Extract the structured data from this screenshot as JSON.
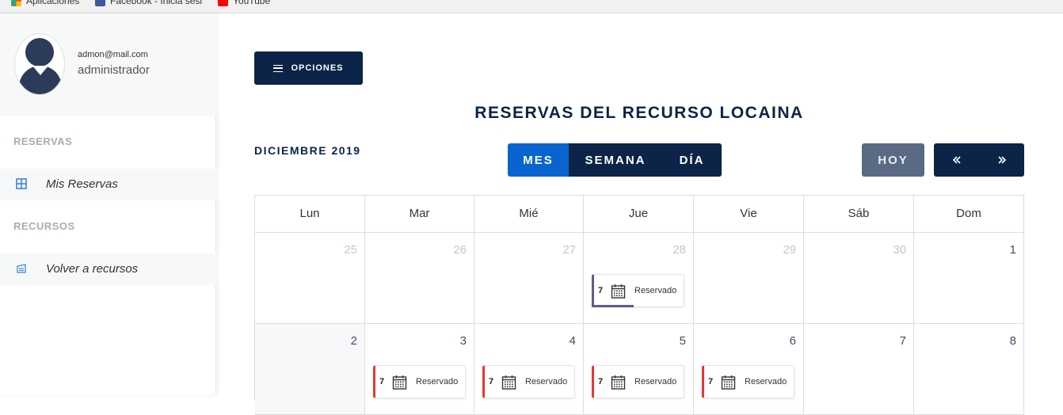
{
  "bookmarks": [
    {
      "label": "Aplicaciones",
      "icon": "apps-icon"
    },
    {
      "label": "Facebook - Inicia sesi",
      "icon": "facebook-icon"
    },
    {
      "label": "YouTube",
      "icon": "youtube-icon"
    }
  ],
  "sidebar": {
    "email": "admon@mail.com",
    "role": "administrador",
    "sections": [
      {
        "heading": "RESERVAS",
        "items": [
          {
            "label": "Mis Reservas",
            "icon": "grid-icon"
          }
        ]
      },
      {
        "heading": "RECURSOS",
        "items": [
          {
            "label": "Volver a recursos",
            "icon": "return-icon"
          }
        ]
      }
    ]
  },
  "main": {
    "options_label": "OPCIONES",
    "title": "RESERVAS DEL RECURSO LOCAINA",
    "month": "DICIEMBRE 2019",
    "views": [
      "MES",
      "SEMANA",
      "DÍA"
    ],
    "active_view": "MES",
    "today_label": "HOY",
    "prev_icon": "double-chevron-left-icon",
    "next_icon": "double-chevron-right-icon"
  },
  "calendar": {
    "weekdays": [
      "Lun",
      "Mar",
      "Mié",
      "Jue",
      "Vie",
      "Sáb",
      "Dom"
    ],
    "weeks": [
      {
        "days": [
          "25",
          "26",
          "27",
          "28",
          "29",
          "30",
          "1"
        ],
        "other_month": [
          true,
          true,
          true,
          true,
          true,
          true,
          false
        ]
      },
      {
        "days": [
          "2",
          "3",
          "4",
          "5",
          "6",
          "7",
          "8"
        ],
        "other_month": [
          false,
          false,
          false,
          false,
          false,
          false,
          false
        ]
      }
    ],
    "events": [
      {
        "week": 0,
        "day": 3,
        "count": "7",
        "label": "Reservado",
        "color": "#5c5f8a"
      },
      {
        "week": 1,
        "day": 1,
        "count": "7",
        "label": "Reservado",
        "color": "#e53935"
      },
      {
        "week": 1,
        "day": 2,
        "count": "7",
        "label": "Reservado",
        "color": "#e53935"
      },
      {
        "week": 1,
        "day": 3,
        "count": "7",
        "label": "Reservado",
        "color": "#e53935"
      },
      {
        "week": 1,
        "day": 4,
        "count": "7",
        "label": "Reservado",
        "color": "#e53935"
      }
    ]
  },
  "colors": {
    "primary": "#0b2447",
    "active": "#0a64cf",
    "today": "#5a6a84",
    "event_red": "#e53935",
    "event_purple": "#5c5f8a"
  }
}
